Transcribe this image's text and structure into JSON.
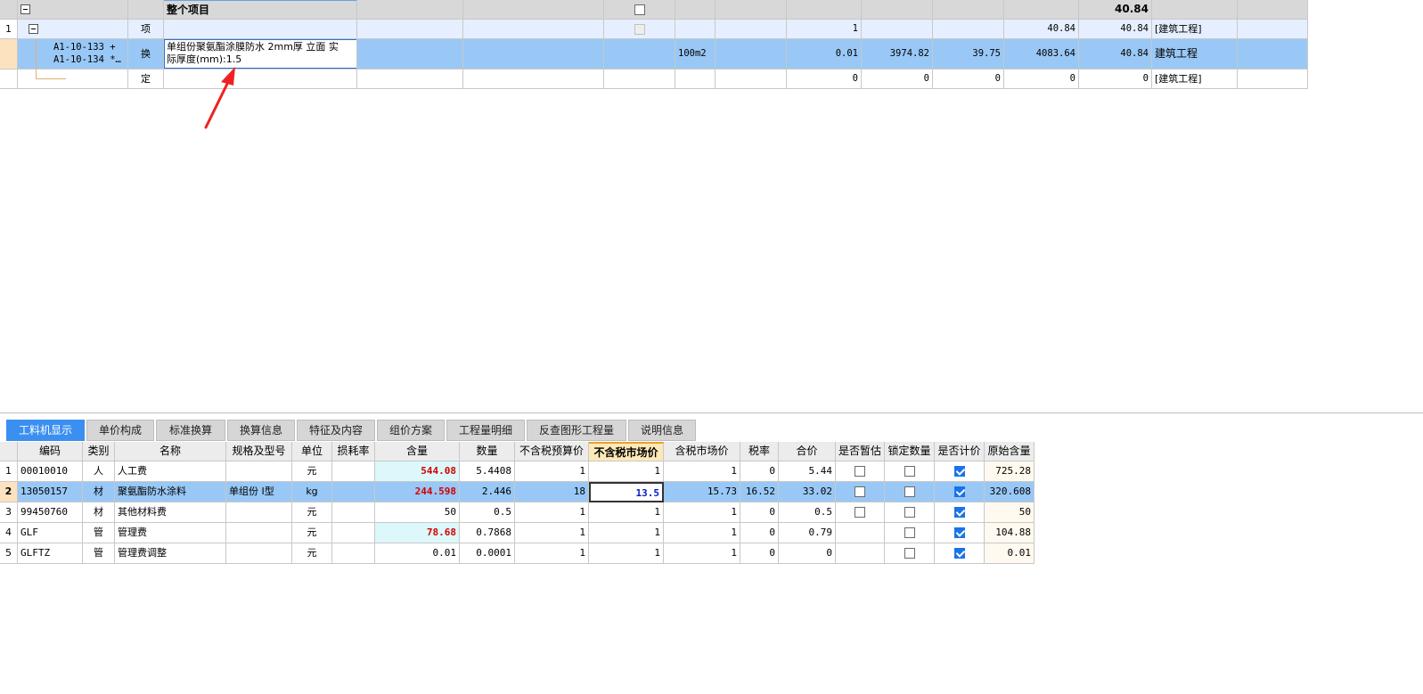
{
  "top_grid": {
    "header_row": {
      "title": "整个项目",
      "total": "40.84"
    },
    "rows": [
      {
        "idx": "1",
        "code": "",
        "type": "项",
        "name": "",
        "unit": "",
        "qty": "1",
        "c1": "",
        "c2": "",
        "c3": "40.84",
        "c4": "40.84",
        "category": "[建筑工程]"
      },
      {
        "idx": "",
        "code_line1": "A1-10-133 +",
        "code_line2": "A1-10-134 *…",
        "type": "换",
        "name_line1": "单组份聚氨酯涂膜防水 2mm厚 立面  实",
        "name_line2": "际厚度(mm):1.5",
        "unit": "100m2",
        "qty": "0.01",
        "c1": "3974.82",
        "c2": "39.75",
        "c3": "4083.64",
        "c4": "40.84",
        "category": "建筑工程"
      },
      {
        "idx": "",
        "code": "",
        "type": "定",
        "name": "",
        "unit": "",
        "qty": "0",
        "c1": "0",
        "c2": "0",
        "c3": "0",
        "c4": "0",
        "category": "[建筑工程]"
      }
    ]
  },
  "tabs": [
    "工料机显示",
    "单价构成",
    "标准换算",
    "换算信息",
    "特征及内容",
    "组价方案",
    "工程量明细",
    "反查图形工程量",
    "说明信息"
  ],
  "active_tab": "工料机显示",
  "bottom_grid": {
    "headers": [
      "",
      "编码",
      "类别",
      "名称",
      "规格及型号",
      "单位",
      "损耗率",
      "含量",
      "数量",
      "不含税预算价",
      "不含税市场价",
      "含税市场价",
      "税率",
      "合价",
      "是否暂估",
      "锁定数量",
      "是否计价",
      "原始含量"
    ],
    "rows": [
      {
        "idx": "1",
        "code": "00010010",
        "cat": "人",
        "name": "人工费",
        "spec": "",
        "unit": "元",
        "loss": "",
        "content": "544.08",
        "qty": "5.4408",
        "budget": "1",
        "market": "1",
        "market_tax": "1",
        "tax": "0",
        "total": "5.44",
        "est": false,
        "lock": false,
        "priced": true,
        "orig": "725.28"
      },
      {
        "idx": "2",
        "code": "13050157",
        "cat": "材",
        "name": "聚氨酯防水涂料",
        "spec": "单组份 I型",
        "unit": "kg",
        "loss": "",
        "content": "244.598",
        "qty": "2.446",
        "budget": "18",
        "market": "13.5",
        "market_tax": "15.73",
        "tax": "16.52",
        "total": "33.02",
        "est": false,
        "lock": false,
        "priced": true,
        "orig": "320.608"
      },
      {
        "idx": "3",
        "code": "99450760",
        "cat": "材",
        "name": "其他材料费",
        "spec": "",
        "unit": "元",
        "loss": "",
        "content": "50",
        "qty": "0.5",
        "budget": "1",
        "market": "1",
        "market_tax": "1",
        "tax": "0",
        "total": "0.5",
        "est": false,
        "lock": false,
        "priced": true,
        "orig": "50"
      },
      {
        "idx": "4",
        "code": "GLF",
        "cat": "管",
        "name": "管理费",
        "spec": "",
        "unit": "元",
        "loss": "",
        "content": "78.68",
        "qty": "0.7868",
        "budget": "1",
        "market": "1",
        "market_tax": "1",
        "tax": "0",
        "total": "0.79",
        "est": null,
        "lock": false,
        "priced": true,
        "orig": "104.88"
      },
      {
        "idx": "5",
        "code": "GLFTZ",
        "cat": "管",
        "name": "管理费调整",
        "spec": "",
        "unit": "元",
        "loss": "",
        "content": "0.01",
        "qty": "0.0001",
        "budget": "1",
        "market": "1",
        "market_tax": "1",
        "tax": "0",
        "total": "0",
        "est": null,
        "lock": false,
        "priced": true,
        "orig": "0.01"
      }
    ]
  },
  "colors": {
    "selected_row": "#99c8f6",
    "active_tab": "#3b8ff0",
    "arrow": "#ee2222"
  }
}
